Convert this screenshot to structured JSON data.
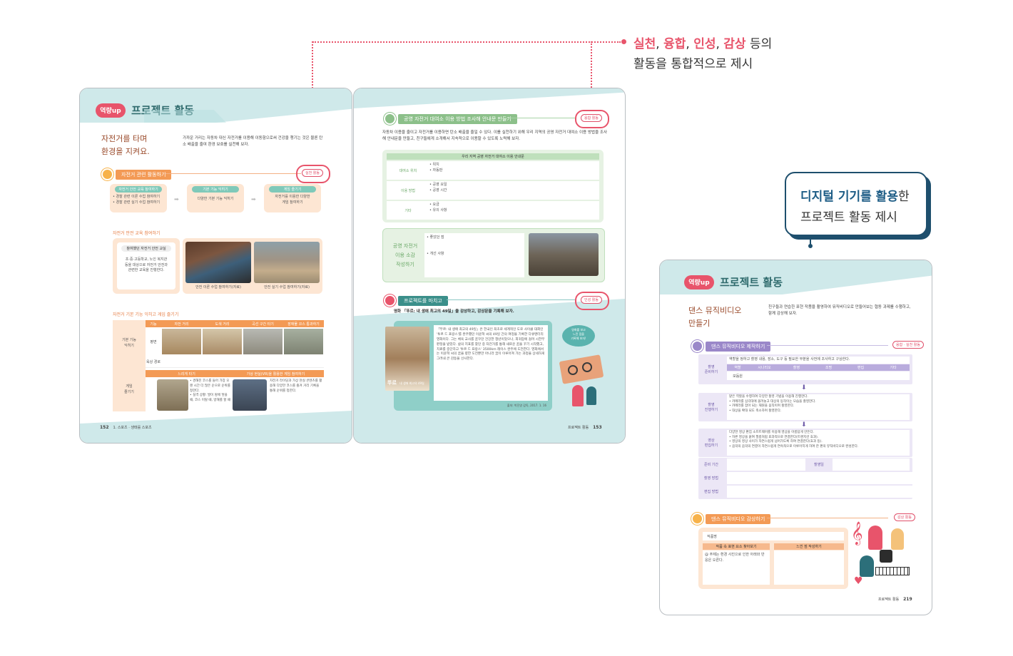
{
  "annotation_top": {
    "highlight_words": [
      "실천",
      "융합",
      "인성",
      "감상"
    ],
    "separator": ", ",
    "suffix": " 등의",
    "line2": "활동을 통합적으로 제시"
  },
  "callout_right": {
    "highlight": "디지털 기기를 활용",
    "rest": "한",
    "line2": "프로젝트 활동 제시"
  },
  "colors": {
    "accent_pink": "#e8546b",
    "teal_band": "#cfe9ea",
    "navy": "#1e4f6d",
    "orange": "#f39a55"
  },
  "left_spread": {
    "badge": "역량up",
    "banner_title": "프로젝트 활동",
    "subtitle_line1": "자전거를 타며",
    "subtitle_line2": "환경을 지켜요.",
    "intro": "가까운 거리는 자동차 대신 자전거를 이용해 이동함으로써 건강을 챙기는 것은 물론 탄소 배출을 줄여 환경 보호를 실천해 보자.",
    "section1": "자전거 관련 활동하기",
    "section1_tag": "실천 활동",
    "flow": [
      {
        "head": "자전거 안전 교육 참여하기",
        "body": "• 경찰 관련 이론 수업 참여하기\n• 경찰 관련 실기 수업 참여하기"
      },
      {
        "head": "기본 기능 익히기",
        "body": "다양한 기본 기능 익히기"
      },
      {
        "head": "게임 즐기기",
        "body": "자전거를 이용한 다양한\n게임 참여하기"
      }
    ],
    "sub1_title": "자전거 안전 교육 참여하기",
    "sub1_box_head": "참여했던 자전거 안전 교실",
    "sub1_box_body": "초·중·고등학교, 노인 복지관 등을 대상으로 자전거 안전과 관련한 교육을 진행한다.",
    "photo_caption1": "안전 이론 수업 참여하기(자료)",
    "photo_caption2": "안전 실기 수업 참여하기(자료)",
    "sub2_title": "자전거 기본 기능 익히고 게임 즐기기",
    "table_cols": [
      "기능",
      "자전 거리",
      "도색 거리",
      "곡선 구간 타기",
      "장애물 코스 통과하기"
    ],
    "table_rows": [
      "평면",
      "육상 경로"
    ],
    "table_left_label1": "기본 기능\n익히기",
    "table_left_label2": "게임\n즐기기",
    "game_cols": [
      "느리게 타기",
      "가상 현실(VR)을 활용한 게임 참여하기"
    ],
    "game_text1": "• 경해진 코스를 들어 가장 오랜 시간 더 많은 순으로 순위를 정한다.\n• 실격 상황: 발이 땅에 닿을 때, 코스 이탈 때, 방해를 할 때",
    "game_text2": "자전거 라이딩과 가상 현실 콘텐츠를 활용해 다양한 코스를 즐겨 거리 기록을 통해 순위를 정한다.",
    "footer_left": "152",
    "footer_left_text": "1. 스포츠 · 생태를 스포츠",
    "footer_right_text": "프로젝트 활동",
    "footer_right": "153",
    "right_section1": "공영 자전거 대여소 이용 방법 조사해 안내문 만들기",
    "right_section1_tag": "융합 활동",
    "right_intro": "자동차 이용을 줄이고 자전거를 이용하면 탄소 배출을 줄일 수 있다. 이를 실천하기 위해 우리 지역의 공영 자전거 대여소 이용 방법을 조사해 안내문을 만들고, 친구들에게 소개해서 지속적으로 이용할 수 있도록 노력해 보자.",
    "info_title": "우리 지역 공영 자전거 대여소 이용 안내문",
    "info_rows": [
      {
        "k": "대여소 위치",
        "v": "• 위치\n• 자동판"
      },
      {
        "k": "이용 방법",
        "v": "• 공영 요일\n• 공영 시간"
      },
      {
        "k": "기타",
        "v": "• 요금\n• 유의 사항"
      }
    ],
    "card_title": "공영 자전거\n이용 소감\n작성하기",
    "card_items": "• 좋았던 점\n\n\n• 개선 사항",
    "right_section2": "프로젝트를 마치고",
    "right_section2_tag": "인성 활동",
    "film_heading": "영화 「뚜르: 내 생애 최고의 49일」을 감상하고, 감상문을 기록해 보자.",
    "film_text": "「뚜르: 내 생애 최고의 49일」은 한국인 최초로 세계적인 도로 사이클 대회인 '투르 드 프랑스'를 완주했던 이윤혁 씨의 49일 간의 여정을 기록한 다큐멘터리 영화이다. 그는 체육 교사를 꿈꾸던 건강한 청년이었으나, 희귀암에 걸려 시한부 판정을 받았다. 삶의 지표를 찾던 중 자전거를 통해 새로운 꿈을 꾸기 시작했고, 치료를 중단하고 '투르 드 프랑스' 3500km 레이스 완주에 도전한다. 영화에서는 이윤혁 씨의 꿈을 향한 도전뿐만 아니라 꿈이 이루어져 가는 과정을 상세하게 그려내 큰 감동을 선사한다.",
    "film_source": "출처: 박진영 감독, 2017. 1. 16",
    "poster_label": "뚜르",
    "poster_sub": "내 생애 최고의 49일",
    "speech": "영화를 보고\n느낀 점을\n기록해 보자!"
  },
  "right_page": {
    "badge": "역량up",
    "banner_title": "프로젝트 활동",
    "subtitle_line1": "댄스 뮤직비디오",
    "subtitle_line2": "만들기",
    "intro": "친구들과 연습한 표현 작품을 촬영하여 뮤직비디오로 만들어보는 협동 과제를 수행하고, 함께 감상해 보자.",
    "section1": "댄스 뮤직비디오 제작하기",
    "section1_tag": "융합 · 실천 활동",
    "step1_label": "촬영\n준비하기",
    "step1_text": "역할을 정하고 촬영 내용, 장소, 도구 등 필요한 부분을 사전에 조사하고 구상한다.",
    "step1_cols": [
      "역할",
      "시나리오",
      "촬영",
      "조명",
      "편집",
      "기타"
    ],
    "step1_row": "모둠원",
    "step2_label": "촬영\n진행하기",
    "step2_text": "맡은 역할을 수행하여 다양한 촬영 기법을 이용해 진행한다.\n• 카메라를 삼각대에 올려놓고 대상의 동작이는 모습을 촬영한다.\n• 카메라를 잡아 되는 재원을 움직이며 촬영한다.\n• 대상을 확대 되도 축소하며 촬영한다.",
    "step3_label": "영상\n편집하기",
    "step3_text": "다양한 영상 편집 소프트웨어를 이용해 영상을 아름답게 만든다.\n• 자른 영상을 붙여 필름처럼 표과적으로 연결한다(트랜지션 효과).\n• 영상의 영상 사이가 자연스럽게 넘어가도록 하여 연결한다(효과 등).\n• 음악의 음악의 연결이 자연스럽게 연속적으로 이루어지게 하여 한 편의 뮤직비디오로 완성한다.",
    "record_rows": [
      "준비 기간",
      "촬영 방법",
      "편집 방법"
    ],
    "record_mid": "촬영일",
    "section2": "댄스 뮤직비디오 감상하기",
    "section2_tag": "감상 활동",
    "watch_label": "작품명",
    "watch_col1": "작품 속 표현 요소 찾아보기",
    "watch_col2": "느낀 점 작성하기",
    "watch_text": "@ 주제는 환경 사진으로 인한 아래와 반응은 오른다.",
    "footer_text": "프로젝트 활동",
    "footer_num": "219"
  }
}
